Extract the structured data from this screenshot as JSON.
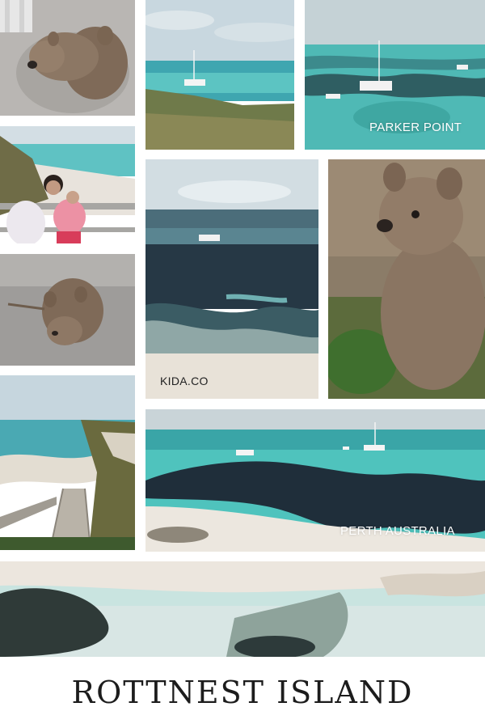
{
  "captions": {
    "parker_point": "PARKER POINT",
    "kida": "KIDA.CO",
    "perth": "PERTH AUSTRALIA"
  },
  "title": "ROTTNEST ISLAND",
  "photos": [
    "quokka-pair-photo",
    "sailboat-bay-photo",
    "parker-point-yachts-photo",
    "mother-daughter-beach-photo",
    "quokka-on-gravel-photo",
    "boat-reef-shore-photo",
    "quokka-closeup-photo",
    "boardwalk-beach-photo",
    "perth-bay-reef-photo",
    "aerial-shallows-photo"
  ],
  "colors": {
    "sea_turquoise": "#4fc3bd",
    "reef_dark": "#2b3a44",
    "sand": "#ece7df",
    "sky": "#c9d8df",
    "quokka_fur": "#8a7562"
  }
}
